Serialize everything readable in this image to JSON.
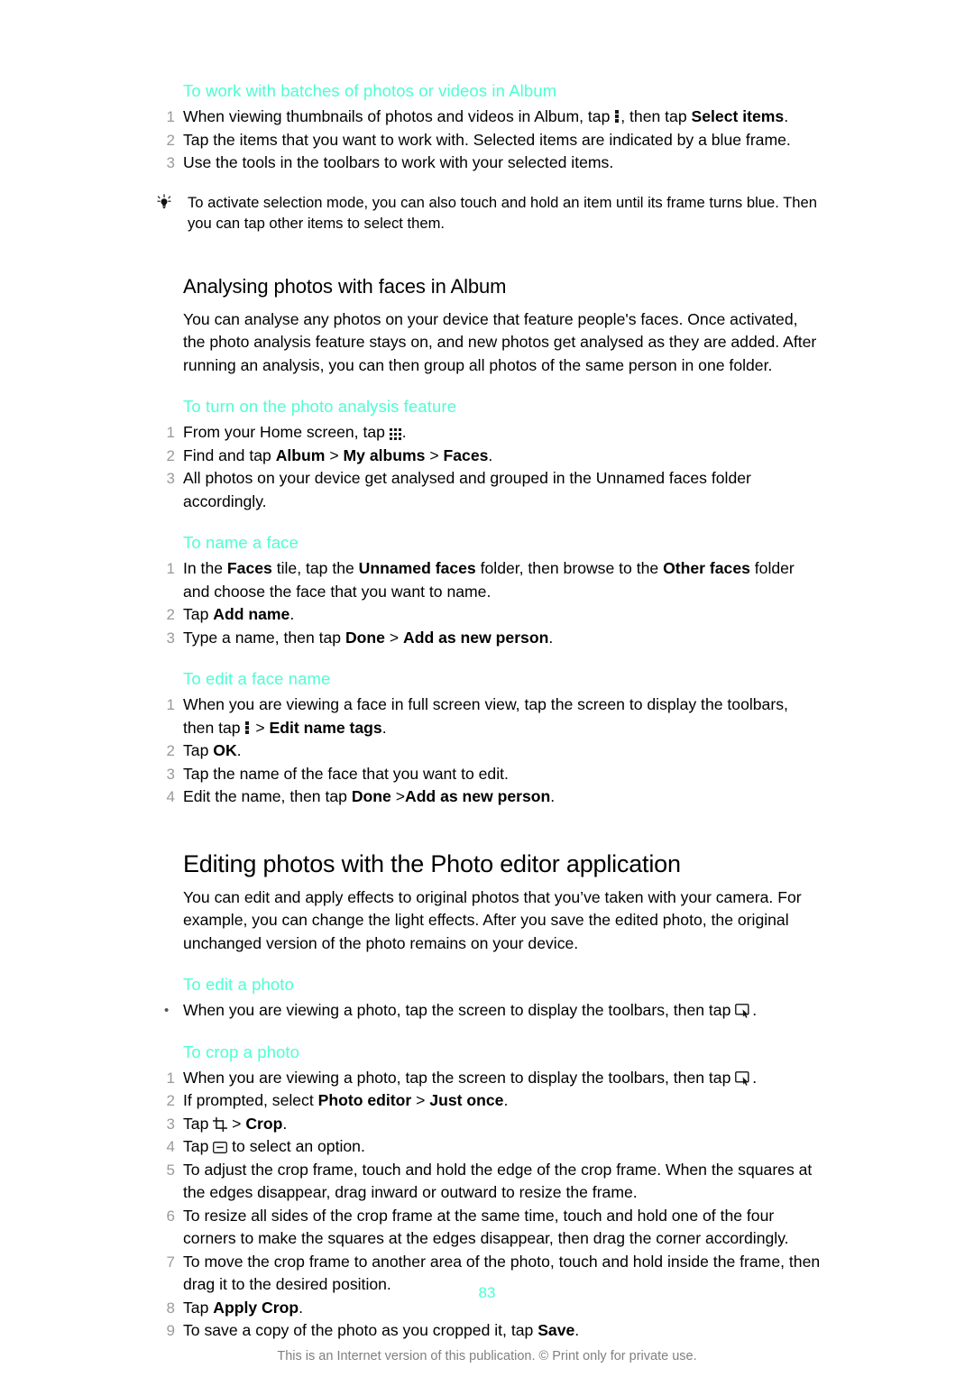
{
  "colors": {
    "heading_teal": "#4dffd2",
    "step_number_gray": "#9a9a9a",
    "footer_gray": "#808080",
    "body_black": "#000000"
  },
  "sections": {
    "batches": {
      "heading": "To work with batches of photos or videos in Album",
      "steps": [
        {
          "num": "1",
          "parts": [
            {
              "t": "text",
              "v": "When viewing thumbnails of photos and videos in Album, tap "
            },
            {
              "t": "icon",
              "v": "overflow-menu-icon"
            },
            {
              "t": "text",
              "v": ", then tap "
            },
            {
              "t": "bold",
              "v": "Select items"
            },
            {
              "t": "text",
              "v": "."
            }
          ]
        },
        {
          "num": "2",
          "parts": [
            {
              "t": "text",
              "v": "Tap the items that you want to work with. Selected items are indicated by a blue frame."
            }
          ]
        },
        {
          "num": "3",
          "parts": [
            {
              "t": "text",
              "v": "Use the tools in the toolbars to work with your selected items."
            }
          ]
        }
      ],
      "tip": "To activate selection mode, you can also touch and hold an item until its frame turns blue. Then you can tap other items to select them."
    },
    "analysing": {
      "heading": "Analysing photos with faces in Album",
      "intro": "You can analyse any photos on your device that feature people's faces. Once activated, the photo analysis feature stays on, and new photos get analysed as they are added. After running an analysis, you can then group all photos of the same person in one folder."
    },
    "turn_on_analysis": {
      "heading": "To turn on the photo analysis feature",
      "steps": [
        {
          "num": "1",
          "parts": [
            {
              "t": "text",
              "v": "From your Home screen, tap "
            },
            {
              "t": "icon",
              "v": "app-grid-icon"
            },
            {
              "t": "text",
              "v": "."
            }
          ]
        },
        {
          "num": "2",
          "parts": [
            {
              "t": "text",
              "v": "Find and tap "
            },
            {
              "t": "bold",
              "v": "Album"
            },
            {
              "t": "text",
              "v": " > "
            },
            {
              "t": "bold",
              "v": "My albums"
            },
            {
              "t": "text",
              "v": " > "
            },
            {
              "t": "bold",
              "v": "Faces"
            },
            {
              "t": "text",
              "v": "."
            }
          ]
        },
        {
          "num": "3",
          "parts": [
            {
              "t": "text",
              "v": "All photos on your device get analysed and grouped in the Unnamed faces folder accordingly."
            }
          ]
        }
      ]
    },
    "name_face": {
      "heading": "To name a face",
      "steps": [
        {
          "num": "1",
          "parts": [
            {
              "t": "text",
              "v": "In the "
            },
            {
              "t": "bold",
              "v": "Faces"
            },
            {
              "t": "text",
              "v": " tile, tap the "
            },
            {
              "t": "bold",
              "v": "Unnamed faces"
            },
            {
              "t": "text",
              "v": " folder, then browse to the "
            },
            {
              "t": "bold",
              "v": "Other faces"
            },
            {
              "t": "text",
              "v": " folder and choose the face that you want to name."
            }
          ]
        },
        {
          "num": "2",
          "parts": [
            {
              "t": "text",
              "v": "Tap "
            },
            {
              "t": "bold",
              "v": "Add name"
            },
            {
              "t": "text",
              "v": "."
            }
          ]
        },
        {
          "num": "3",
          "parts": [
            {
              "t": "text",
              "v": "Type a name, then tap "
            },
            {
              "t": "bold",
              "v": "Done"
            },
            {
              "t": "text",
              "v": " > "
            },
            {
              "t": "bold",
              "v": "Add as new person"
            },
            {
              "t": "text",
              "v": "."
            }
          ]
        }
      ]
    },
    "edit_face_name": {
      "heading": "To edit a face name",
      "steps": [
        {
          "num": "1",
          "parts": [
            {
              "t": "text",
              "v": "When you are viewing a face in full screen view, tap the screen to display the toolbars, then tap "
            },
            {
              "t": "icon",
              "v": "overflow-menu-icon"
            },
            {
              "t": "text",
              "v": " > "
            },
            {
              "t": "bold",
              "v": "Edit name tags"
            },
            {
              "t": "text",
              "v": "."
            }
          ]
        },
        {
          "num": "2",
          "parts": [
            {
              "t": "text",
              "v": "Tap "
            },
            {
              "t": "bold",
              "v": "OK"
            },
            {
              "t": "text",
              "v": "."
            }
          ]
        },
        {
          "num": "3",
          "parts": [
            {
              "t": "text",
              "v": "Tap the name of the face that you want to edit."
            }
          ]
        },
        {
          "num": "4",
          "parts": [
            {
              "t": "text",
              "v": "Edit the name, then tap "
            },
            {
              "t": "bold",
              "v": "Done"
            },
            {
              "t": "text",
              "v": " >"
            },
            {
              "t": "bold",
              "v": "Add as new person"
            },
            {
              "t": "text",
              "v": "."
            }
          ]
        }
      ]
    },
    "photo_editor": {
      "heading": "Editing photos with the Photo editor application",
      "intro": "You can edit and apply effects to original photos that you’ve taken with your camera. For example, you can change the light effects. After you save the edited photo, the original unchanged version of the photo remains on your device."
    },
    "edit_photo": {
      "heading": "To edit a photo",
      "steps": [
        {
          "num": "•",
          "parts": [
            {
              "t": "text",
              "v": "When you are viewing a photo, tap the screen to display the toolbars, then tap "
            },
            {
              "t": "icon",
              "v": "photo-edit-icon"
            },
            {
              "t": "text",
              "v": "."
            }
          ]
        }
      ]
    },
    "crop_photo": {
      "heading": "To crop a photo",
      "steps": [
        {
          "num": "1",
          "parts": [
            {
              "t": "text",
              "v": "When you are viewing a photo, tap the screen to display the toolbars, then tap "
            },
            {
              "t": "icon",
              "v": "photo-edit-icon"
            },
            {
              "t": "text",
              "v": "."
            }
          ]
        },
        {
          "num": "2",
          "parts": [
            {
              "t": "text",
              "v": "If prompted, select "
            },
            {
              "t": "bold",
              "v": "Photo editor"
            },
            {
              "t": "text",
              "v": " > "
            },
            {
              "t": "bold",
              "v": "Just once"
            },
            {
              "t": "text",
              "v": "."
            }
          ]
        },
        {
          "num": "3",
          "parts": [
            {
              "t": "text",
              "v": "Tap "
            },
            {
              "t": "icon",
              "v": "crop-tool-icon"
            },
            {
              "t": "text",
              "v": " > "
            },
            {
              "t": "bold",
              "v": "Crop"
            },
            {
              "t": "text",
              "v": "."
            }
          ]
        },
        {
          "num": "4",
          "parts": [
            {
              "t": "text",
              "v": "Tap "
            },
            {
              "t": "icon",
              "v": "option-button-icon"
            },
            {
              "t": "text",
              "v": " to select an option."
            }
          ]
        },
        {
          "num": "5",
          "parts": [
            {
              "t": "text",
              "v": "To adjust the crop frame, touch and hold the edge of the crop frame. When the squares at the edges disappear, drag inward or outward to resize the frame."
            }
          ]
        },
        {
          "num": "6",
          "parts": [
            {
              "t": "text",
              "v": "To resize all sides of the crop frame at the same time, touch and hold one of the four corners to make the squares at the edges disappear, then drag the corner accordingly."
            }
          ]
        },
        {
          "num": "7",
          "parts": [
            {
              "t": "text",
              "v": "To move the crop frame to another area of the photo, touch and hold inside the frame, then drag it to the desired position."
            }
          ]
        },
        {
          "num": "8",
          "parts": [
            {
              "t": "text",
              "v": "Tap "
            },
            {
              "t": "bold",
              "v": "Apply Crop"
            },
            {
              "t": "text",
              "v": "."
            }
          ]
        },
        {
          "num": "9",
          "parts": [
            {
              "t": "text",
              "v": "To save a copy of the photo as you cropped it, tap "
            },
            {
              "t": "bold",
              "v": "Save"
            },
            {
              "t": "text",
              "v": "."
            }
          ]
        }
      ]
    }
  },
  "footer": {
    "page_number": "83",
    "note": "This is an Internet version of this publication. © Print only for private use."
  }
}
